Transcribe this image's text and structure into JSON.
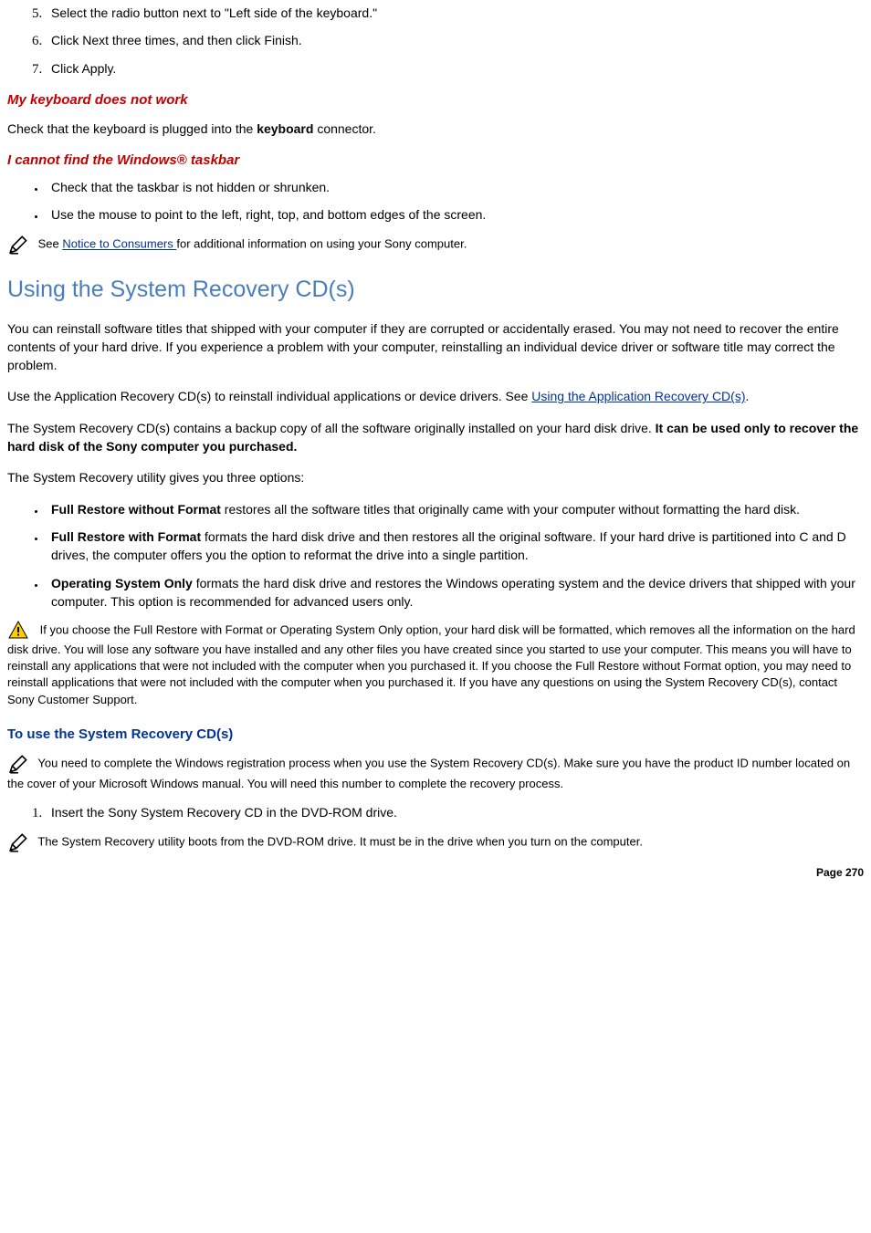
{
  "ol1": {
    "i5": "Select the radio button next to \"Left side of the keyboard.\"",
    "i6": "Click Next three times, and then click Finish.",
    "i7": "Click Apply."
  },
  "h_keyboard": "My keyboard does not work",
  "p_keyboard_a": "Check that the keyboard is plugged into the ",
  "p_keyboard_b_bold": "keyboard",
  "p_keyboard_c": " connector.",
  "h_taskbar": "I cannot find the Windows® taskbar",
  "ul_taskbar": {
    "i1": "Check that the taskbar is not hidden or shrunken.",
    "i2": "Use the mouse to point to the left, right, top, and bottom edges of the screen."
  },
  "note_consumers_a": " See ",
  "note_consumers_link": "Notice to Consumers ",
  "note_consumers_b": "for additional information on using your Sony computer.",
  "h_recovery": "Using the System Recovery CD(s)",
  "p_rec1": "You can reinstall software titles that shipped with your computer if they are corrupted or accidentally erased. You may not need to recover the entire contents of your hard drive. If you experience a problem with your computer, reinstalling an individual device driver or software title may correct the problem.",
  "p_rec2_a": "Use the Application Recovery CD(s) to reinstall individual applications or device drivers. See ",
  "p_rec2_link": "Using the Application Recovery CD(s)",
  "p_rec2_b": ".",
  "p_rec3_a": "The System Recovery CD(s) contains a backup copy of all the software originally installed on your hard disk drive. ",
  "p_rec3_bold": "It can be used only to recover the hard disk of the Sony computer you purchased.",
  "p_rec4": "The System Recovery utility gives you three options:",
  "ul_options": {
    "o1_b": "Full Restore without Format",
    "o1_t": " restores all the software titles that originally came with your computer without formatting the hard disk.",
    "o2_b": "Full Restore with Format",
    "o2_t": " formats the hard disk drive and then restores all the original software. If your hard drive is partitioned into C and D drives, the computer offers you the option to reformat the drive into a single partition.",
    "o3_b": "Operating System Only",
    "o3_t": " formats the hard disk drive and restores the Windows operating system and the device drivers that shipped with your computer. This option is recommended for advanced users only."
  },
  "warn_p": " If you choose the Full Restore with Format or Operating System Only option, your hard disk will be formatted, which removes all the information on the hard disk drive. You will lose any software you have installed and any other files you have created since you started to use your computer. This means you will have to reinstall any applications that were not included with the computer when you purchased it. If you choose the Full Restore without Format option, you may need to reinstall applications that were not included with the computer when you purchased it. If you have any questions on using the System Recovery CD(s), contact Sony Customer Support.",
  "h_touse": "To use the System Recovery CD(s)",
  "note_reg": " You need to complete the Windows registration process when you use the System Recovery CD(s). Make sure you have the product ID number located on the cover of your Microsoft Windows manual. You will need this number to complete the recovery process.",
  "ol2": {
    "i1": "Insert the Sony System Recovery CD in the DVD-ROM drive."
  },
  "note_boot": " The System Recovery utility boots from the DVD-ROM drive. It must be in the drive when you turn on the computer.",
  "footer": "Page 270"
}
